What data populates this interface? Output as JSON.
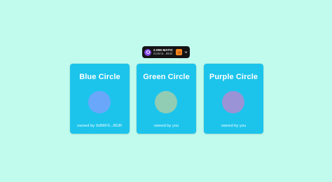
{
  "wallet": {
    "balance": "2.096 MATIC",
    "address": "0x39A5...89dd",
    "token_icon": "polygon-icon",
    "wallet_icon": "metamask-fox-icon"
  },
  "cards": [
    {
      "title": "Blue Circle",
      "owner": "owned by 0xB6F0...853F",
      "color": "#6aa7fb"
    },
    {
      "title": "Green Circle",
      "owner": "owned by you",
      "color": "#91ccb4"
    },
    {
      "title": "Purple Circle",
      "owner": "owned by you",
      "color": "#9a93d6"
    }
  ],
  "colors": {
    "background": "#c0fbee",
    "card": "#1cc4ec",
    "wallet_bg": "#141414"
  }
}
